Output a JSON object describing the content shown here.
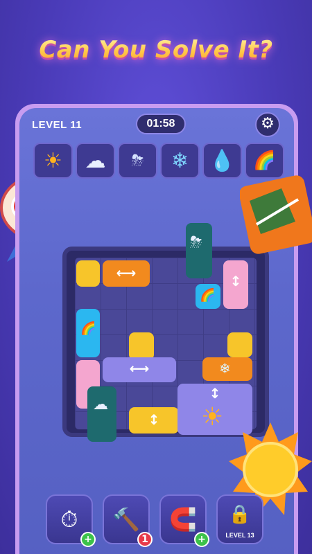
{
  "headline": "Can You Solve It?",
  "hud": {
    "level_label": "LEVEL 11",
    "timer": "01:58",
    "settings_icon": "gear-icon"
  },
  "weather_slots": [
    {
      "icon": "sun-icon",
      "glyph": "☀"
    },
    {
      "icon": "cloud-icon",
      "glyph": "☁"
    },
    {
      "icon": "thunder-cloud-icon",
      "glyph": "⛈"
    },
    {
      "icon": "snowflake-icon",
      "glyph": "❄"
    },
    {
      "icon": "water-drop-icon",
      "glyph": "💧"
    },
    {
      "icon": "rainbow-icon",
      "glyph": "🌈"
    }
  ],
  "tools": [
    {
      "name": "freeze-timer-tool",
      "glyph": "⏱",
      "badge": "+",
      "badge_color": "#3cc24a"
    },
    {
      "name": "hammer-tool",
      "glyph": "🔨",
      "badge": "1",
      "badge_color": "#e83a4a"
    },
    {
      "name": "magnet-tool",
      "glyph": "🧲",
      "badge": "+",
      "badge_color": "#3cc24a"
    },
    {
      "name": "locked-tool",
      "glyph": "🔒",
      "locked_label": "LEVEL 13"
    }
  ],
  "colors": {
    "background": "#4a3bb8",
    "frame": "#c89cf0",
    "yellow_block": "#f7c52a",
    "orange_block": "#f28a1e",
    "blue_block": "#2bb7f0",
    "pink_block": "#f4a6cf",
    "teal_block": "#1e6a6e",
    "purple_block": "#8f86e8"
  }
}
